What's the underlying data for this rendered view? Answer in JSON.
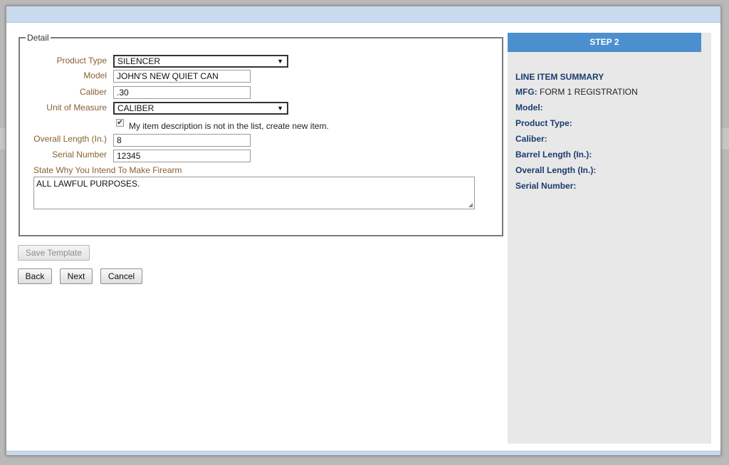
{
  "detail": {
    "legend": "Detail",
    "product_type": {
      "label": "Product Type",
      "value": "SILENCER"
    },
    "model": {
      "label": "Model",
      "value": "JOHN'S NEW QUIET CAN"
    },
    "caliber": {
      "label": "Caliber",
      "value": ".30"
    },
    "unit_of_measure": {
      "label": "Unit of Measure",
      "value": "CALIBER"
    },
    "new_item_checkbox": {
      "label": "My item description is not in the list, create new item.",
      "checked": true
    },
    "overall_length": {
      "label": "Overall Length (In.)",
      "value": "8"
    },
    "serial_number": {
      "label": "Serial Number",
      "value": "12345"
    },
    "intent": {
      "label": "State Why You Intend To Make Firearm",
      "value": "ALL LAWFUL PURPOSES."
    }
  },
  "buttons": {
    "save_template": "Save Template",
    "back": "Back",
    "next": "Next",
    "cancel": "Cancel"
  },
  "summary": {
    "step": "STEP 2",
    "title": "LINE ITEM SUMMARY",
    "mfg_label": "MFG:",
    "mfg_value": "FORM 1 REGISTRATION",
    "model_label": "Model:",
    "product_type_label": "Product Type:",
    "caliber_label": "Caliber:",
    "barrel_length_label": "Barrel Length (In.):",
    "overall_length_label": "Overall Length (In.):",
    "serial_number_label": "Serial Number:"
  },
  "colors": {
    "header_bar": "#c9d9ee",
    "step_banner": "#4c8fcf",
    "label_brown": "#8a6030",
    "summary_blue": "#1a3c6e"
  }
}
